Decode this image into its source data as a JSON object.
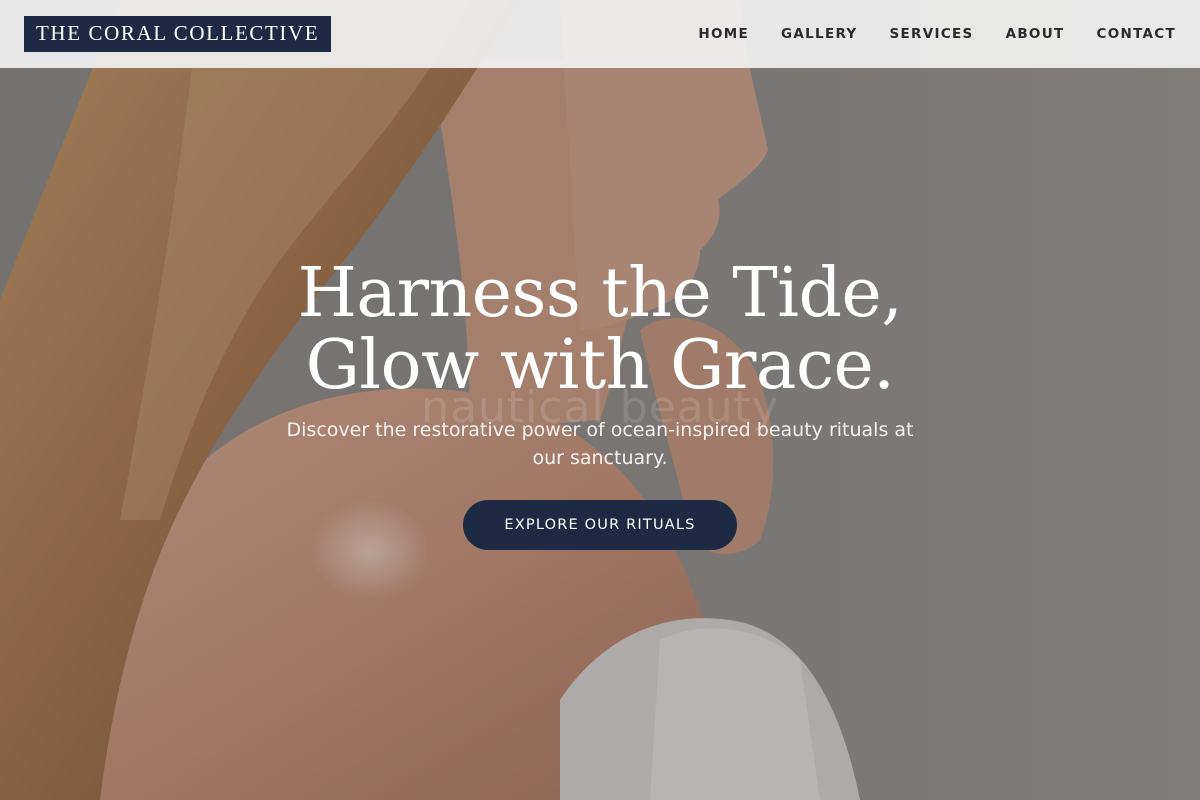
{
  "header": {
    "logo_text": "THE CORAL COLLECTIVE",
    "nav": [
      {
        "label": "HOME"
      },
      {
        "label": "GALLERY"
      },
      {
        "label": "SERVICES"
      },
      {
        "label": "ABOUT"
      },
      {
        "label": "CONTACT"
      }
    ]
  },
  "hero": {
    "title_line1": "Harness the Tide,",
    "title_line2": "Glow with Grace.",
    "faded_background_text": "nautical beauty",
    "subtitle": "Discover the restorative power of ocean-inspired beauty rituals at our sanctuary.",
    "cta_label": "EXPLORE OUR RITUALS"
  },
  "colors": {
    "brand_navy": "#1e2a44",
    "header_bg": "#f0f0f0",
    "hero_text": "#ffffff"
  }
}
